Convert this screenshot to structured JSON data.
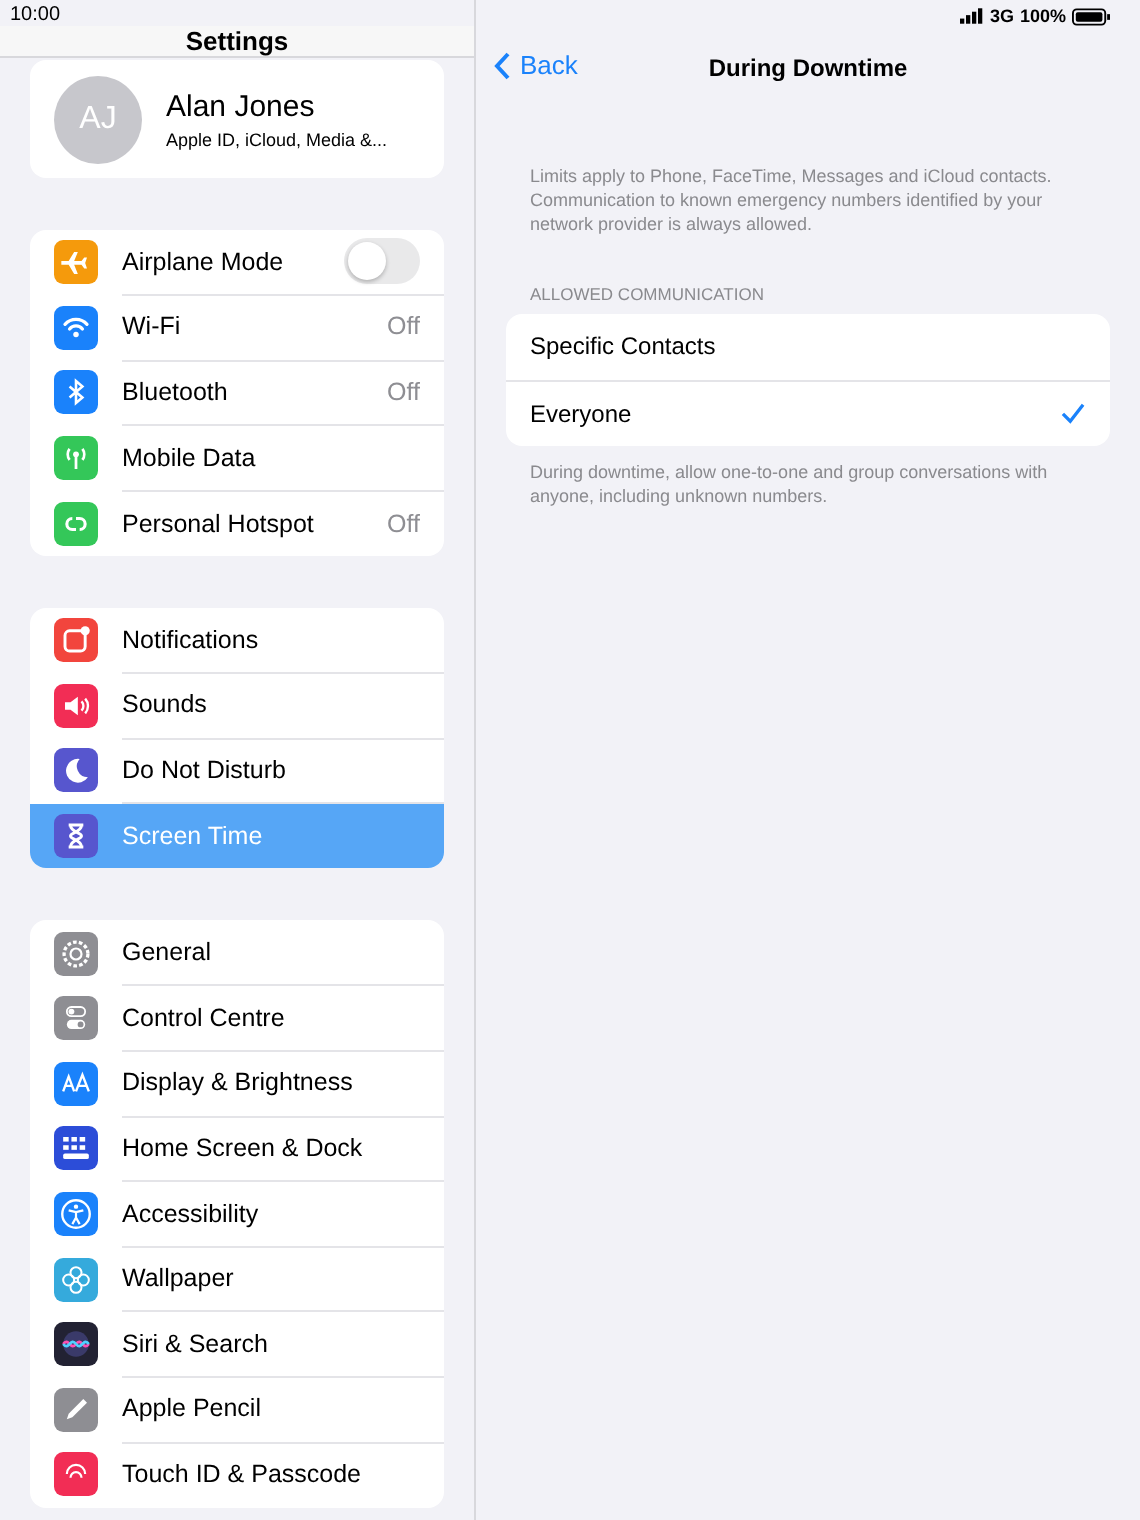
{
  "status_bar": {
    "time": "10:00",
    "network": "3G",
    "battery": "100%"
  },
  "sidebar": {
    "title": "Settings",
    "profile": {
      "initials": "AJ",
      "name": "Alan Jones",
      "subtitle": "Apple ID, iCloud, Media &..."
    },
    "groups": [
      [
        {
          "label": "Airplane Mode",
          "toggle": {
            "on": false
          },
          "selected": false
        },
        {
          "label": "Wi-Fi",
          "value": "Off",
          "selected": false
        },
        {
          "label": "Bluetooth",
          "value": "Off",
          "selected": false
        },
        {
          "label": "Mobile Data",
          "selected": false
        },
        {
          "label": "Personal Hotspot",
          "value": "Off",
          "selected": false
        }
      ],
      [
        {
          "label": "Notifications",
          "selected": false
        },
        {
          "label": "Sounds",
          "selected": false
        },
        {
          "label": "Do Not Disturb",
          "selected": false
        },
        {
          "label": "Screen Time",
          "selected": true
        }
      ],
      [
        {
          "label": "General",
          "selected": false
        },
        {
          "label": "Control Centre",
          "selected": false
        },
        {
          "label": "Display & Brightness",
          "selected": false
        },
        {
          "label": "Home Screen & Dock",
          "selected": false
        },
        {
          "label": "Accessibility",
          "selected": false
        },
        {
          "label": "Wallpaper",
          "selected": false
        },
        {
          "label": "Siri & Search",
          "selected": false
        },
        {
          "label": "Apple Pencil",
          "selected": false
        },
        {
          "label": "Touch ID & Passcode",
          "selected": false
        }
      ]
    ]
  },
  "detail": {
    "back": "Back",
    "title": "During Downtime",
    "intro": "Limits apply to Phone, FaceTime, Messages and iCloud contacts. Communication to known emergency numbers identified by your network provider is always allowed.",
    "section_header": "ALLOWED COMMUNICATION",
    "options": [
      {
        "label": "Specific Contacts",
        "selected": false
      },
      {
        "label": "Everyone",
        "selected": true
      }
    ],
    "footer": "During downtime, allow one-to-one and group conversations with anyone, including unknown numbers."
  }
}
